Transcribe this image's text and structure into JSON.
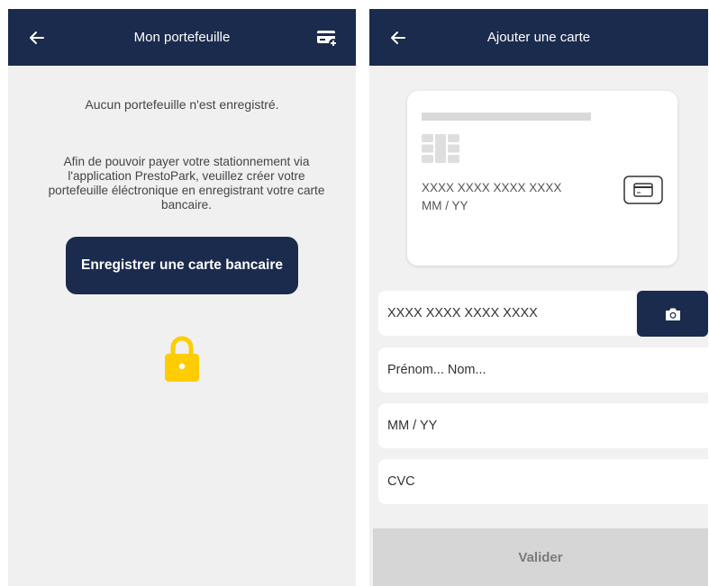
{
  "wallet_screen": {
    "title": "Mon portefeuille",
    "empty_message": "Aucun portefeuille n'est enregistré.",
    "info_message": "Afin de pouvoir payer votre stationnement via l'application PrestoPark, veuillez créer votre portefeuille éléctronique en enregistrant votre carte bancaire.",
    "register_button_label": "Enregistrer une carte bancaire",
    "icons": [
      "back-arrow-icon",
      "add-card-icon",
      "lock-icon"
    ],
    "colors": {
      "header": "#1b2b4d",
      "lock": "#ffcc00",
      "background": "#f0f0f0"
    }
  },
  "add_card_screen": {
    "title": "Ajouter une carte",
    "card_preview": {
      "number": "XXXX XXXX XXXX XXXX",
      "expiry": "MM / YY",
      "icons": [
        "chip-icon",
        "credit-card-icon"
      ]
    },
    "fields": {
      "card_number_placeholder": "XXXX XXXX XXXX XXXX",
      "name_placeholder": "Prénom... Nom...",
      "expiry_placeholder": "MM / YY",
      "cvc_placeholder": "CVC"
    },
    "camera_icon": "camera-icon",
    "submit_label": "Valider",
    "colors": {
      "header": "#1b2b4d",
      "submit_disabled": "#d6d6d6"
    }
  }
}
